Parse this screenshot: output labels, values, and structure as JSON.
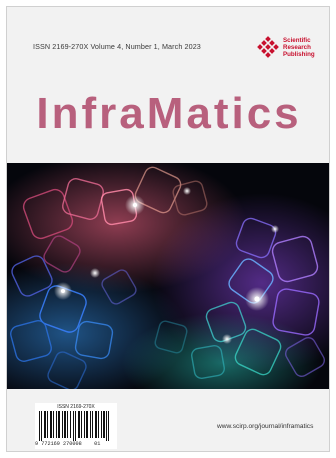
{
  "header": {
    "issn_line": "ISSN 2169-270X   Volume 4, Number 1, March 2023",
    "publisher_name": "Scientific\nResearch\nPublishing"
  },
  "journal": {
    "title": "InfraMatics"
  },
  "footer": {
    "barcode_issn": "ISSN 2169-270X",
    "barcode_digits": "9 772169 270008    01",
    "url": "www.scirp.org/journal/inframatics"
  },
  "colors": {
    "title": "#b8607d",
    "publisher": "#c8102e"
  }
}
